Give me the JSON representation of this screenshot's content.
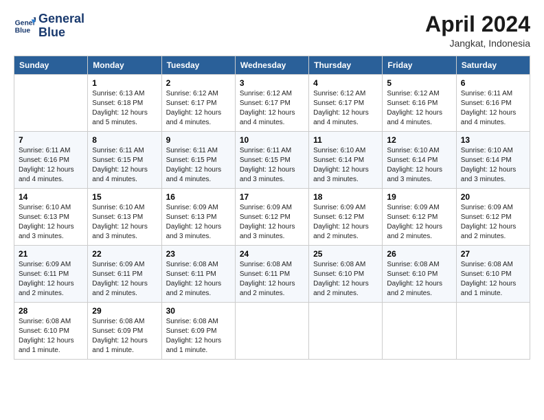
{
  "logo": {
    "line1": "General",
    "line2": "Blue"
  },
  "title": "April 2024",
  "subtitle": "Jangkat, Indonesia",
  "weekdays": [
    "Sunday",
    "Monday",
    "Tuesday",
    "Wednesday",
    "Thursday",
    "Friday",
    "Saturday"
  ],
  "weeks": [
    [
      {
        "day": "",
        "info": ""
      },
      {
        "day": "1",
        "info": "Sunrise: 6:13 AM\nSunset: 6:18 PM\nDaylight: 12 hours\nand 5 minutes."
      },
      {
        "day": "2",
        "info": "Sunrise: 6:12 AM\nSunset: 6:17 PM\nDaylight: 12 hours\nand 4 minutes."
      },
      {
        "day": "3",
        "info": "Sunrise: 6:12 AM\nSunset: 6:17 PM\nDaylight: 12 hours\nand 4 minutes."
      },
      {
        "day": "4",
        "info": "Sunrise: 6:12 AM\nSunset: 6:17 PM\nDaylight: 12 hours\nand 4 minutes."
      },
      {
        "day": "5",
        "info": "Sunrise: 6:12 AM\nSunset: 6:16 PM\nDaylight: 12 hours\nand 4 minutes."
      },
      {
        "day": "6",
        "info": "Sunrise: 6:11 AM\nSunset: 6:16 PM\nDaylight: 12 hours\nand 4 minutes."
      }
    ],
    [
      {
        "day": "7",
        "info": "Sunrise: 6:11 AM\nSunset: 6:16 PM\nDaylight: 12 hours\nand 4 minutes."
      },
      {
        "day": "8",
        "info": "Sunrise: 6:11 AM\nSunset: 6:15 PM\nDaylight: 12 hours\nand 4 minutes."
      },
      {
        "day": "9",
        "info": "Sunrise: 6:11 AM\nSunset: 6:15 PM\nDaylight: 12 hours\nand 4 minutes."
      },
      {
        "day": "10",
        "info": "Sunrise: 6:11 AM\nSunset: 6:15 PM\nDaylight: 12 hours\nand 3 minutes."
      },
      {
        "day": "11",
        "info": "Sunrise: 6:10 AM\nSunset: 6:14 PM\nDaylight: 12 hours\nand 3 minutes."
      },
      {
        "day": "12",
        "info": "Sunrise: 6:10 AM\nSunset: 6:14 PM\nDaylight: 12 hours\nand 3 minutes."
      },
      {
        "day": "13",
        "info": "Sunrise: 6:10 AM\nSunset: 6:14 PM\nDaylight: 12 hours\nand 3 minutes."
      }
    ],
    [
      {
        "day": "14",
        "info": "Sunrise: 6:10 AM\nSunset: 6:13 PM\nDaylight: 12 hours\nand 3 minutes."
      },
      {
        "day": "15",
        "info": "Sunrise: 6:10 AM\nSunset: 6:13 PM\nDaylight: 12 hours\nand 3 minutes."
      },
      {
        "day": "16",
        "info": "Sunrise: 6:09 AM\nSunset: 6:13 PM\nDaylight: 12 hours\nand 3 minutes."
      },
      {
        "day": "17",
        "info": "Sunrise: 6:09 AM\nSunset: 6:12 PM\nDaylight: 12 hours\nand 3 minutes."
      },
      {
        "day": "18",
        "info": "Sunrise: 6:09 AM\nSunset: 6:12 PM\nDaylight: 12 hours\nand 2 minutes."
      },
      {
        "day": "19",
        "info": "Sunrise: 6:09 AM\nSunset: 6:12 PM\nDaylight: 12 hours\nand 2 minutes."
      },
      {
        "day": "20",
        "info": "Sunrise: 6:09 AM\nSunset: 6:12 PM\nDaylight: 12 hours\nand 2 minutes."
      }
    ],
    [
      {
        "day": "21",
        "info": "Sunrise: 6:09 AM\nSunset: 6:11 PM\nDaylight: 12 hours\nand 2 minutes."
      },
      {
        "day": "22",
        "info": "Sunrise: 6:09 AM\nSunset: 6:11 PM\nDaylight: 12 hours\nand 2 minutes."
      },
      {
        "day": "23",
        "info": "Sunrise: 6:08 AM\nSunset: 6:11 PM\nDaylight: 12 hours\nand 2 minutes."
      },
      {
        "day": "24",
        "info": "Sunrise: 6:08 AM\nSunset: 6:11 PM\nDaylight: 12 hours\nand 2 minutes."
      },
      {
        "day": "25",
        "info": "Sunrise: 6:08 AM\nSunset: 6:10 PM\nDaylight: 12 hours\nand 2 minutes."
      },
      {
        "day": "26",
        "info": "Sunrise: 6:08 AM\nSunset: 6:10 PM\nDaylight: 12 hours\nand 2 minutes."
      },
      {
        "day": "27",
        "info": "Sunrise: 6:08 AM\nSunset: 6:10 PM\nDaylight: 12 hours\nand 1 minute."
      }
    ],
    [
      {
        "day": "28",
        "info": "Sunrise: 6:08 AM\nSunset: 6:10 PM\nDaylight: 12 hours\nand 1 minute."
      },
      {
        "day": "29",
        "info": "Sunrise: 6:08 AM\nSunset: 6:09 PM\nDaylight: 12 hours\nand 1 minute."
      },
      {
        "day": "30",
        "info": "Sunrise: 6:08 AM\nSunset: 6:09 PM\nDaylight: 12 hours\nand 1 minute."
      },
      {
        "day": "",
        "info": ""
      },
      {
        "day": "",
        "info": ""
      },
      {
        "day": "",
        "info": ""
      },
      {
        "day": "",
        "info": ""
      }
    ]
  ]
}
